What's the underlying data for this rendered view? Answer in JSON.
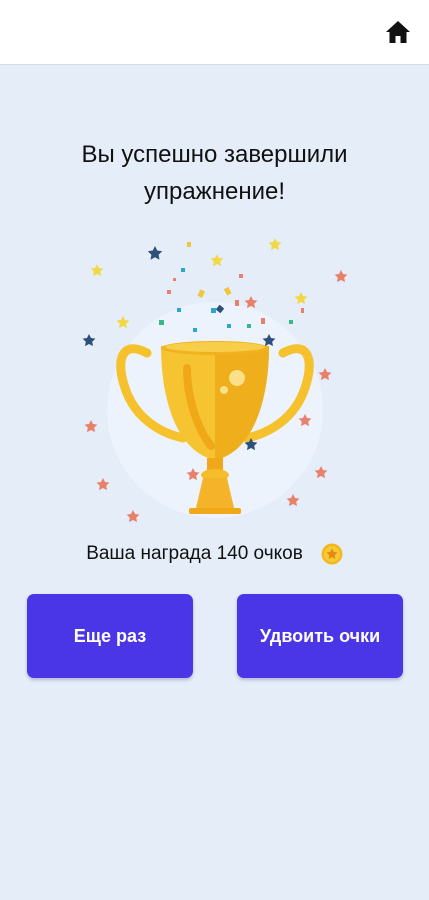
{
  "header": {
    "home_icon": "home-icon"
  },
  "main": {
    "title_line1": "Вы успешно завершили",
    "title_line2": "упражнение!",
    "reward_text": "Ваша награда 140 очков",
    "coin_icon": "coin-star-icon",
    "illustration": "trophy-with-confetti",
    "buttons": {
      "again_label": "Еще раз",
      "double_label": "Удвоить очки"
    }
  },
  "colors": {
    "background": "#e4edf8",
    "header_bg": "#ffffff",
    "button_bg": "#4a36e6",
    "button_text": "#ffffff",
    "trophy_gold": "#f7c431",
    "coin": "#f2b71e"
  }
}
